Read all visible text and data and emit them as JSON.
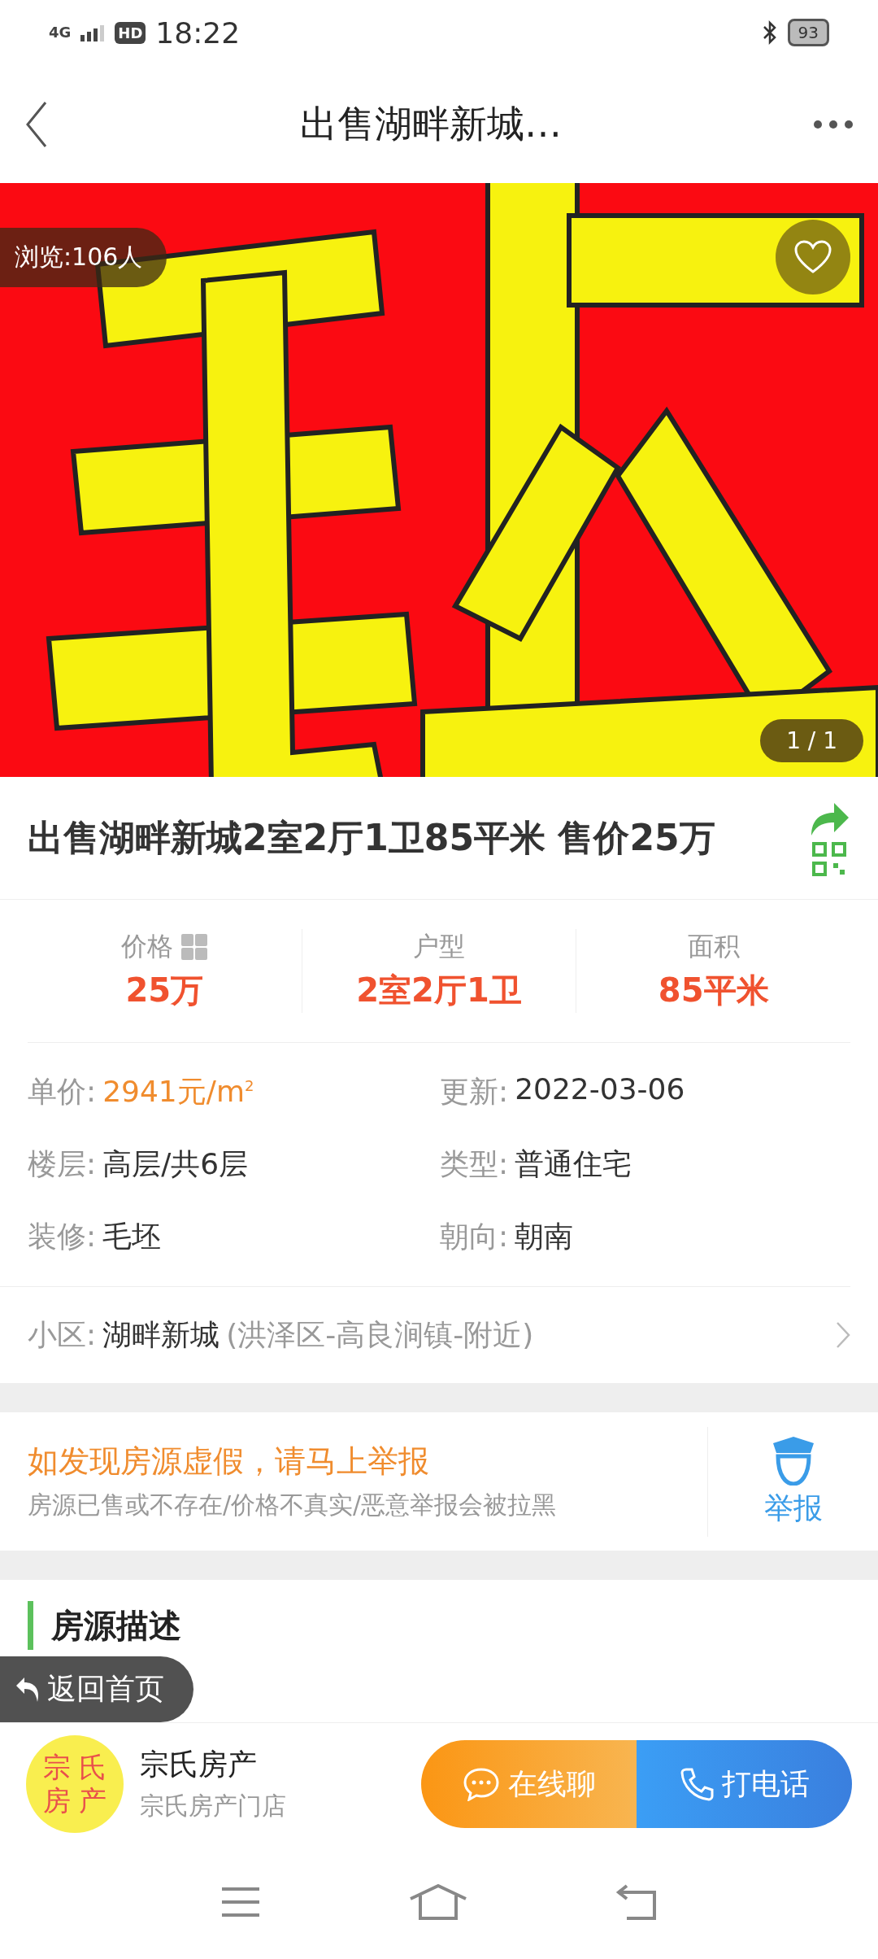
{
  "status_bar": {
    "network": "4G",
    "hd": "HD",
    "time": "18:22",
    "battery": "93"
  },
  "nav": {
    "title": "出售湖畔新城…"
  },
  "gallery": {
    "kind": "picture",
    "views": "浏览:106人",
    "favorited": false,
    "counter": "1 / 1"
  },
  "listing_title": "出售湖畔新城2室2厅1卫85平米 售价25万",
  "stats": [
    {
      "label": "价格",
      "value": "25万",
      "calculator": true
    },
    {
      "label": "户型",
      "value": "2室2厅1卫",
      "calculator": false
    },
    {
      "label": "面积",
      "value": "85平米",
      "calculator": false
    }
  ],
  "details": [
    {
      "label": "单价:",
      "value": "2941元/m$^{2}$",
      "highlight": true
    },
    {
      "label": "更新:",
      "value": "2022-03-06",
      "highlight": false
    },
    {
      "label": "楼层:",
      "value": "高层/共6层",
      "highlight": false
    },
    {
      "label": "类型:",
      "value": "普通住宅",
      "highlight": false
    },
    {
      "label": "装修:",
      "value": "毛坯",
      "highlight": false
    },
    {
      "label": "朝向:",
      "value": "朝南",
      "highlight": false
    }
  ],
  "community": {
    "label": "小区:",
    "name": "湖畔新城",
    "location": "(洪泽区-高良涧镇-附近)"
  },
  "report": {
    "title": "如发现房源虚假，请马上举报",
    "subtitle": "房源已售或不存在/价格不真实/恶意举报会被拉黑",
    "action": "举报"
  },
  "section_title": "房源描述",
  "home_button": "返回首页",
  "agent": {
    "logo_lines": [
      "宗 氏",
      "房 产"
    ],
    "name": "宗氏房产",
    "store": "宗氏房产门店"
  },
  "actions": [
    {
      "kind": "chat",
      "label": "在线聊"
    },
    {
      "kind": "call",
      "label": "打电话"
    }
  ]
}
